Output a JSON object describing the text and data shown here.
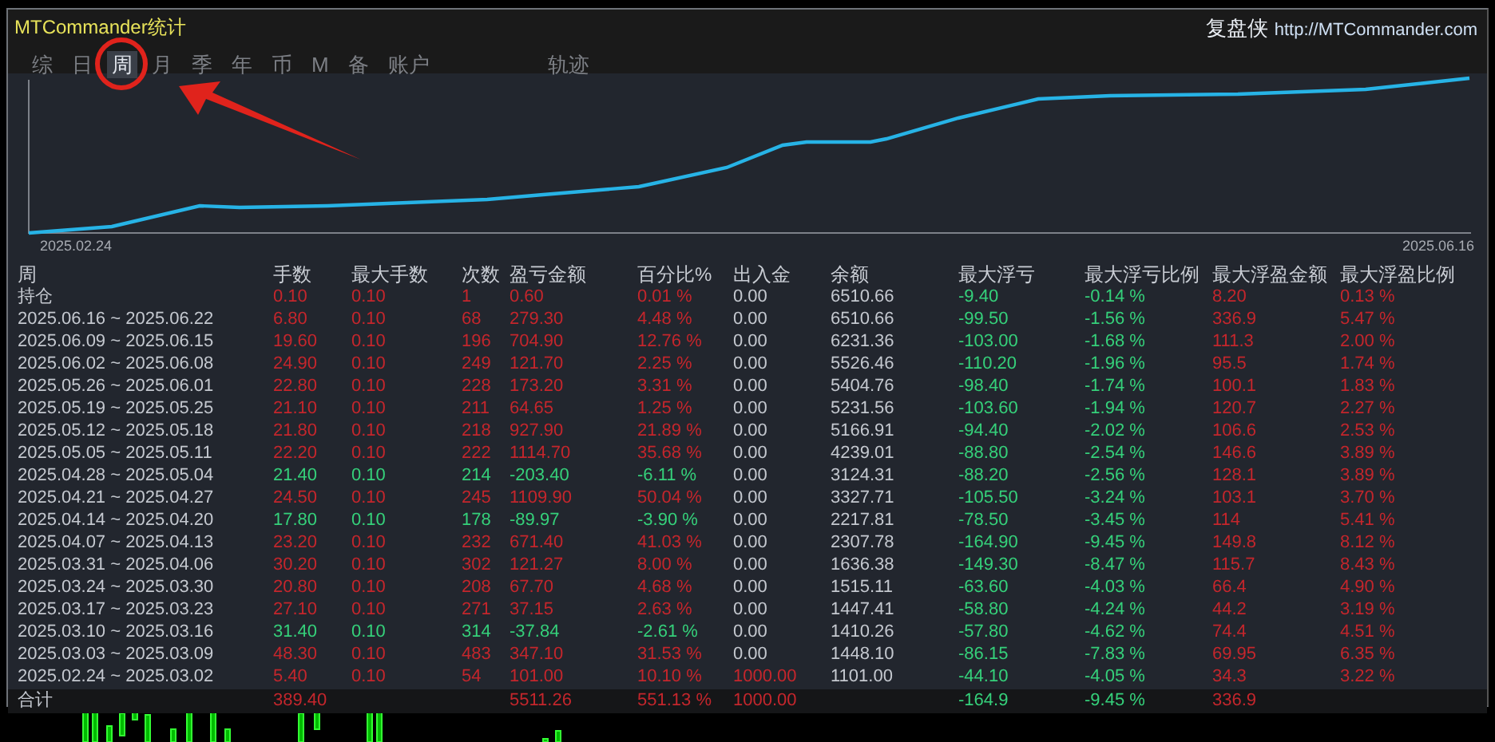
{
  "header": {
    "title": "MTCommander统计",
    "brand": "复盘侠",
    "link": "http://MTCommander.com"
  },
  "tabs": [
    {
      "label": "综",
      "kind": "period",
      "selected": false
    },
    {
      "label": "日",
      "kind": "period",
      "selected": false
    },
    {
      "label": "周",
      "kind": "period",
      "selected": true
    },
    {
      "label": "月",
      "kind": "period",
      "selected": false
    },
    {
      "label": "季",
      "kind": "period",
      "selected": false
    },
    {
      "label": "年",
      "kind": "period",
      "selected": false
    },
    {
      "label": "币",
      "kind": "period",
      "selected": false
    },
    {
      "label": "M",
      "kind": "period",
      "selected": false
    },
    {
      "label": "备",
      "kind": "period",
      "selected": false
    },
    {
      "label": "账户",
      "kind": "period",
      "selected": false
    },
    {
      "label": "轨迹",
      "kind": "view",
      "selected": false
    }
  ],
  "balance_chart": {
    "start_label": "2025.02.24",
    "end_label": "2025.06.16"
  },
  "table": {
    "columns": [
      {
        "label": "周",
        "kind": "label"
      },
      {
        "label": "手数",
        "kind": "result"
      },
      {
        "label": "最大手数",
        "kind": "result"
      },
      {
        "label": "次数",
        "kind": "result"
      },
      {
        "label": "盈亏金额",
        "kind": "result"
      },
      {
        "label": "百分比%",
        "kind": "result"
      },
      {
        "label": "出入金",
        "kind": "deposit"
      },
      {
        "label": "余额",
        "kind": "neutral"
      },
      {
        "label": "最大浮亏",
        "kind": "loss"
      },
      {
        "label": "最大浮亏比例",
        "kind": "loss"
      },
      {
        "label": "最大浮盈金额",
        "kind": "gain"
      },
      {
        "label": "最大浮盈比例",
        "kind": "gain"
      }
    ],
    "rows": [
      {
        "loss": false,
        "deposit_marked": false,
        "cells": [
          "持仓",
          "0.10",
          "0.10",
          "1",
          "0.60",
          "0.01 %",
          "0.00",
          "6510.66",
          "-9.40",
          "-0.14 %",
          "8.20",
          "0.13 %"
        ]
      },
      {
        "loss": false,
        "deposit_marked": false,
        "cells": [
          "2025.06.16 ~ 2025.06.22",
          "6.80",
          "0.10",
          "68",
          "279.30",
          "4.48 %",
          "0.00",
          "6510.66",
          "-99.50",
          "-1.56 %",
          "336.9",
          "5.47 %"
        ]
      },
      {
        "loss": false,
        "deposit_marked": false,
        "cells": [
          "2025.06.09 ~ 2025.06.15",
          "19.60",
          "0.10",
          "196",
          "704.90",
          "12.76 %",
          "0.00",
          "6231.36",
          "-103.00",
          "-1.68 %",
          "111.3",
          "2.00 %"
        ]
      },
      {
        "loss": false,
        "deposit_marked": false,
        "cells": [
          "2025.06.02 ~ 2025.06.08",
          "24.90",
          "0.10",
          "249",
          "121.70",
          "2.25 %",
          "0.00",
          "5526.46",
          "-110.20",
          "-1.96 %",
          "95.5",
          "1.74 %"
        ]
      },
      {
        "loss": false,
        "deposit_marked": false,
        "cells": [
          "2025.05.26 ~ 2025.06.01",
          "22.80",
          "0.10",
          "228",
          "173.20",
          "3.31 %",
          "0.00",
          "5404.76",
          "-98.40",
          "-1.74 %",
          "100.1",
          "1.83 %"
        ]
      },
      {
        "loss": false,
        "deposit_marked": false,
        "cells": [
          "2025.05.19 ~ 2025.05.25",
          "21.10",
          "0.10",
          "211",
          "64.65",
          "1.25 %",
          "0.00",
          "5231.56",
          "-103.60",
          "-1.94 %",
          "120.7",
          "2.27 %"
        ]
      },
      {
        "loss": false,
        "deposit_marked": false,
        "cells": [
          "2025.05.12 ~ 2025.05.18",
          "21.80",
          "0.10",
          "218",
          "927.90",
          "21.89 %",
          "0.00",
          "5166.91",
          "-94.40",
          "-2.02 %",
          "106.6",
          "2.53 %"
        ]
      },
      {
        "loss": false,
        "deposit_marked": false,
        "cells": [
          "2025.05.05 ~ 2025.05.11",
          "22.20",
          "0.10",
          "222",
          "1114.70",
          "35.68 %",
          "0.00",
          "4239.01",
          "-88.80",
          "-2.54 %",
          "146.6",
          "3.89 %"
        ]
      },
      {
        "loss": true,
        "deposit_marked": false,
        "cells": [
          "2025.04.28 ~ 2025.05.04",
          "21.40",
          "0.10",
          "214",
          "-203.40",
          "-6.11 %",
          "0.00",
          "3124.31",
          "-88.20",
          "-2.56 %",
          "128.1",
          "3.89 %"
        ]
      },
      {
        "loss": false,
        "deposit_marked": false,
        "cells": [
          "2025.04.21 ~ 2025.04.27",
          "24.50",
          "0.10",
          "245",
          "1109.90",
          "50.04 %",
          "0.00",
          "3327.71",
          "-105.50",
          "-3.24 %",
          "103.1",
          "3.70 %"
        ]
      },
      {
        "loss": true,
        "deposit_marked": false,
        "cells": [
          "2025.04.14 ~ 2025.04.20",
          "17.80",
          "0.10",
          "178",
          "-89.97",
          "-3.90 %",
          "0.00",
          "2217.81",
          "-78.50",
          "-3.45 %",
          "114",
          "5.41 %"
        ]
      },
      {
        "loss": false,
        "deposit_marked": false,
        "cells": [
          "2025.04.07 ~ 2025.04.13",
          "23.20",
          "0.10",
          "232",
          "671.40",
          "41.03 %",
          "0.00",
          "2307.78",
          "-164.90",
          "-9.45 %",
          "149.8",
          "8.12 %"
        ]
      },
      {
        "loss": false,
        "deposit_marked": false,
        "cells": [
          "2025.03.31 ~ 2025.04.06",
          "30.20",
          "0.10",
          "302",
          "121.27",
          "8.00 %",
          "0.00",
          "1636.38",
          "-149.30",
          "-8.47 %",
          "115.7",
          "8.43 %"
        ]
      },
      {
        "loss": false,
        "deposit_marked": false,
        "cells": [
          "2025.03.24 ~ 2025.03.30",
          "20.80",
          "0.10",
          "208",
          "67.70",
          "4.68 %",
          "0.00",
          "1515.11",
          "-63.60",
          "-4.03 %",
          "66.4",
          "4.90 %"
        ]
      },
      {
        "loss": false,
        "deposit_marked": false,
        "cells": [
          "2025.03.17 ~ 2025.03.23",
          "27.10",
          "0.10",
          "271",
          "37.15",
          "2.63 %",
          "0.00",
          "1447.41",
          "-58.80",
          "-4.24 %",
          "44.2",
          "3.19 %"
        ]
      },
      {
        "loss": true,
        "deposit_marked": false,
        "cells": [
          "2025.03.10 ~ 2025.03.16",
          "31.40",
          "0.10",
          "314",
          "-37.84",
          "-2.61 %",
          "0.00",
          "1410.26",
          "-57.80",
          "-4.62 %",
          "74.4",
          "4.51 %"
        ]
      },
      {
        "loss": false,
        "deposit_marked": false,
        "cells": [
          "2025.03.03 ~ 2025.03.09",
          "48.30",
          "0.10",
          "483",
          "347.10",
          "31.53 %",
          "0.00",
          "1448.10",
          "-86.15",
          "-7.83 %",
          "69.95",
          "6.35 %"
        ]
      },
      {
        "loss": false,
        "deposit_marked": true,
        "cells": [
          "2025.02.24 ~ 2025.03.02",
          "5.40",
          "0.10",
          "54",
          "101.00",
          "10.10 %",
          "1000.00",
          "1101.00",
          "-44.10",
          "-4.05 %",
          "34.3",
          "3.22 %"
        ]
      }
    ],
    "total": {
      "loss": false,
      "deposit_marked": true,
      "cells": [
        "合计",
        "389.40",
        null,
        null,
        "5511.26",
        "551.13 %",
        "1000.00",
        null,
        "-164.9",
        "-9.45 %",
        "336.9",
        null
      ]
    }
  }
}
